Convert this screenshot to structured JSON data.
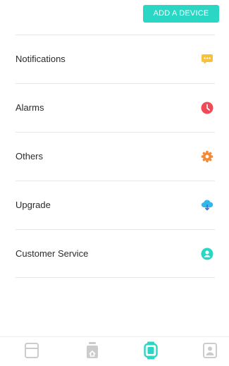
{
  "header": {
    "add_device_label": "ADD A DEVICE"
  },
  "menu": {
    "items": [
      {
        "label": "Notifications",
        "icon": "chat-bubble-icon",
        "color": "#f7c23b"
      },
      {
        "label": "Alarms",
        "icon": "clock-icon",
        "color": "#ef4a55"
      },
      {
        "label": "Others",
        "icon": "gear-icon",
        "color": "#f28a36"
      },
      {
        "label": "Upgrade",
        "icon": "cloud-download-icon",
        "color": "#2fb8ec"
      },
      {
        "label": "Customer Service",
        "icon": "support-agent-icon",
        "color": "#2ad7c4"
      }
    ]
  },
  "tab_bar": {
    "tabs": [
      {
        "icon": "dashboard-icon",
        "active": false
      },
      {
        "icon": "home-device-icon",
        "active": false
      },
      {
        "icon": "watch-icon",
        "active": true
      },
      {
        "icon": "profile-icon",
        "active": false
      }
    ],
    "active_color": "#2ad7c4",
    "inactive_color": "#cccccc"
  }
}
